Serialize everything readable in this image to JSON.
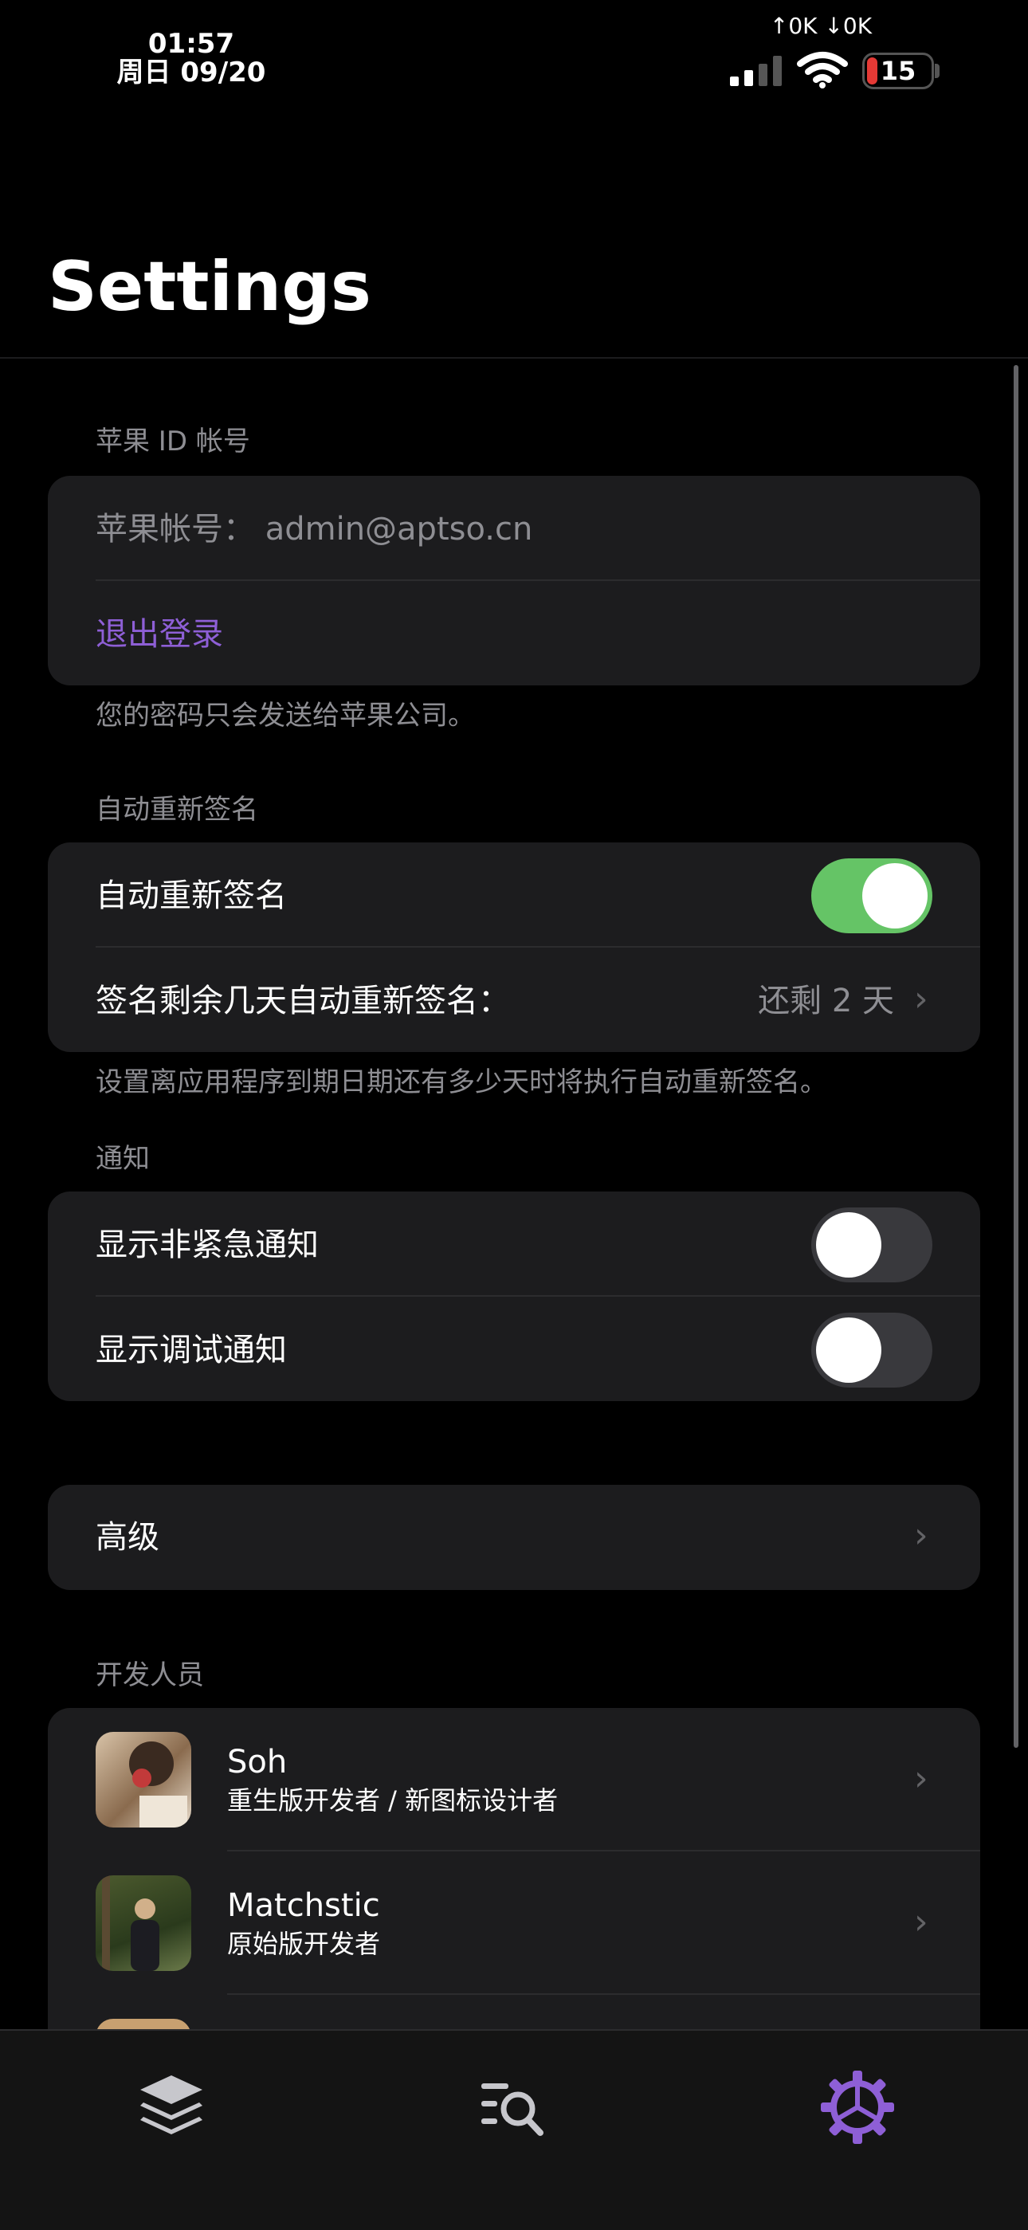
{
  "status_bar": {
    "time": "01:57",
    "date": "周日 09/20",
    "net_speed": "↑0K ↓0K",
    "battery": "15"
  },
  "page_title": "Settings",
  "apple_id": {
    "header": "苹果 ID 帐号",
    "account_text": "苹果帐号： admin@aptso.cn",
    "logout_label": "退出登录",
    "footer": "您的密码只会发送给苹果公司。"
  },
  "auto_resign": {
    "header": "自动重新签名",
    "toggle_label": "自动重新签名",
    "toggle_on": true,
    "days_label": "签名剩余几天自动重新签名：",
    "days_value": "还剩 2 天",
    "footer": "设置离应用程序到期日期还有多少天时将执行自动重新签名。"
  },
  "notifications": {
    "header": "通知",
    "non_urgent_label": "显示非紧急通知",
    "non_urgent_on": false,
    "debug_label": "显示调试通知",
    "debug_on": false
  },
  "advanced": {
    "label": "高级"
  },
  "developers": {
    "header": "开发人员",
    "items": [
      {
        "name": "Soh",
        "role": "重生版开发者 / 新图标设计者"
      },
      {
        "name": "Matchstic",
        "role": "原始版开发者"
      }
    ]
  },
  "tab_bar": {
    "tabs": [
      {
        "icon": "layers-icon",
        "active": false
      },
      {
        "icon": "search-list-icon",
        "active": false
      },
      {
        "icon": "gear-icon",
        "active": true
      }
    ]
  },
  "colors": {
    "accent": "#8e5fd6",
    "toggle_on": "#65c466",
    "card_bg": "#1c1c1e",
    "secondary_text": "#8e8e93"
  }
}
